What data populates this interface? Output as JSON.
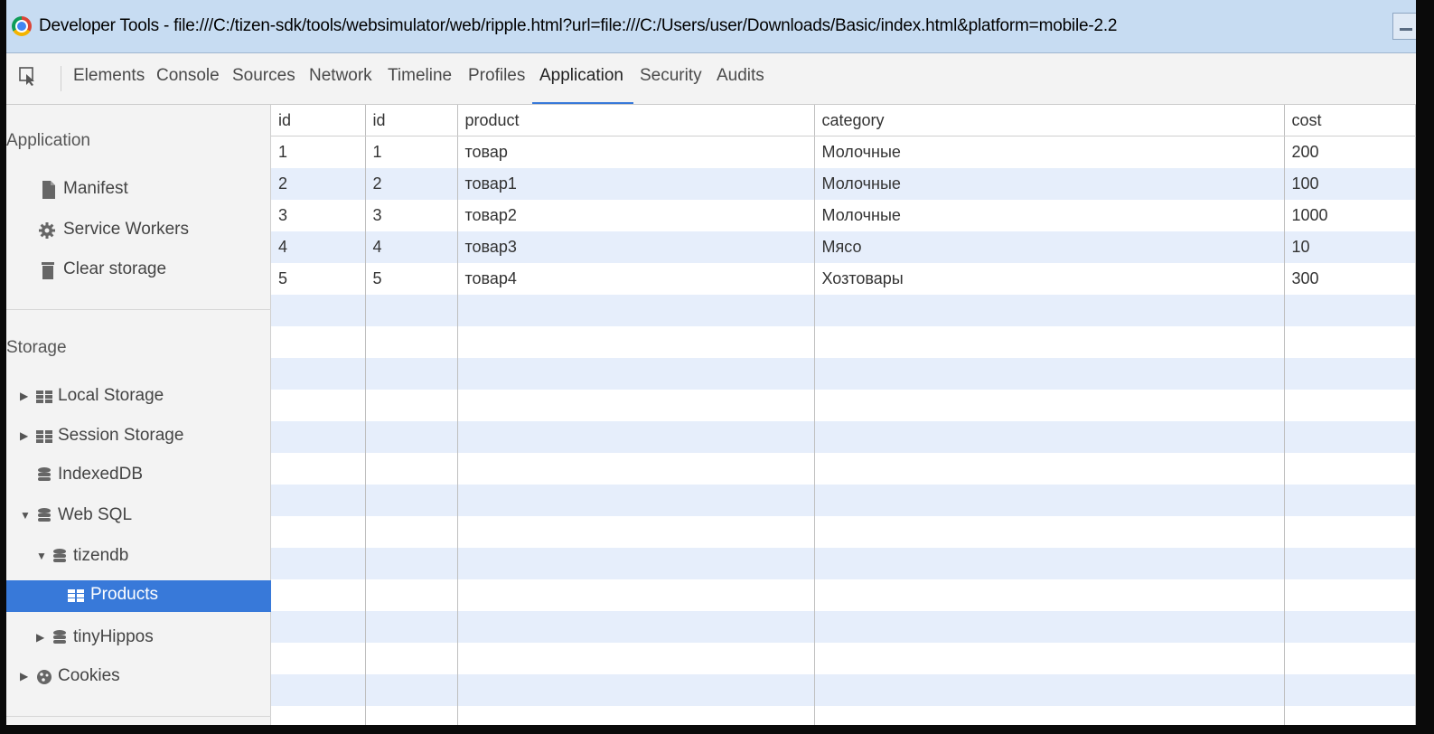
{
  "window": {
    "title": "Developer Tools - file:///C:/tizen-sdk/tools/websimulator/web/ripple.html?url=file:///C:/Users/user/Downloads/Basic/index.html&platform=mobile-2.2"
  },
  "tabs": [
    "Elements",
    "Console",
    "Sources",
    "Network",
    "Timeline",
    "Profiles",
    "Application",
    "Security",
    "Audits"
  ],
  "active_tab": "Application",
  "sidebar": {
    "application_title": "Application",
    "application_items": [
      {
        "label": "Manifest",
        "icon": "file-icon"
      },
      {
        "label": "Service Workers",
        "icon": "gear-icon"
      },
      {
        "label": "Clear storage",
        "icon": "trash-icon"
      }
    ],
    "storage_title": "Storage",
    "storage_items": [
      {
        "label": "Local Storage",
        "icon": "grid-icon",
        "expand": "collapsed"
      },
      {
        "label": "Session Storage",
        "icon": "grid-icon",
        "expand": "collapsed"
      },
      {
        "label": "IndexedDB",
        "icon": "database-icon",
        "expand": "none"
      },
      {
        "label": "Web SQL",
        "icon": "database-icon",
        "expand": "expanded"
      },
      {
        "label": "tizendb",
        "icon": "database-icon",
        "expand": "expanded"
      },
      {
        "label": "Products",
        "icon": "grid-icon",
        "expand": "none",
        "selected": true
      },
      {
        "label": "tinyHippos",
        "icon": "database-icon",
        "expand": "collapsed"
      },
      {
        "label": "Cookies",
        "icon": "cookie-icon",
        "expand": "collapsed"
      }
    ]
  },
  "table": {
    "columns": [
      "id",
      "id",
      "product",
      "category",
      "cost"
    ],
    "rows": [
      [
        "1",
        "1",
        "товар",
        "Молочные",
        "200"
      ],
      [
        "2",
        "2",
        "товар1",
        "Молочные",
        "100"
      ],
      [
        "3",
        "3",
        "товар2",
        "Молочные",
        "1000"
      ],
      [
        "4",
        "4",
        "товар3",
        "Мясо",
        "10"
      ],
      [
        "5",
        "5",
        "товар4",
        "Хозтовары",
        "300"
      ]
    ]
  },
  "colors": {
    "accent": "#3879d9",
    "title_bar": "#c7dcf2",
    "striped_row": "#e6eefb"
  }
}
